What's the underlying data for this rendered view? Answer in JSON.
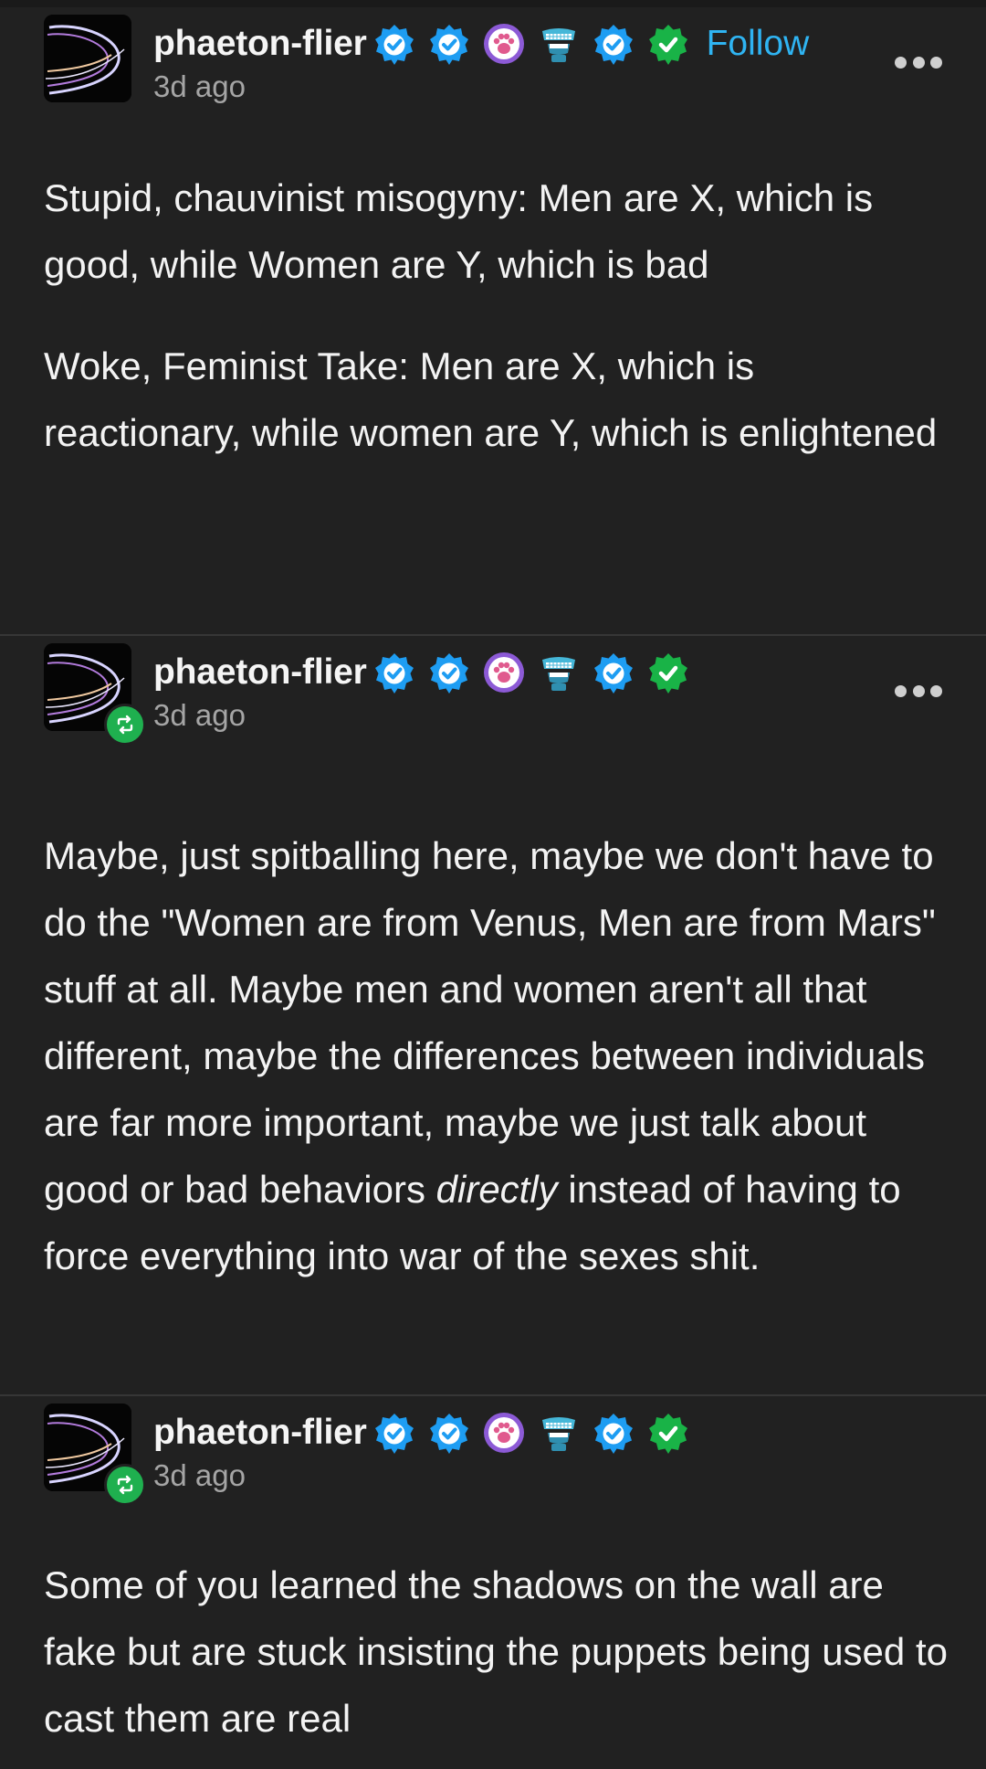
{
  "posts": [
    {
      "username": "phaeton-flier",
      "timestamp": "3d ago",
      "follow_label": "Follow",
      "reblogged": false,
      "badges": [
        "verified-blue-icon",
        "verified-blue-icon",
        "paw-badge-icon",
        "chattering-teeth-icon",
        "verified-blue-icon",
        "verified-green-icon"
      ],
      "paragraphs": [
        "Stupid, chauvinist misogyny: Men are X, which is good, while Women are Y, which is bad",
        "Woke, Feminist Take: Men are X, which is reactionary, while women are Y, which is enlightened"
      ]
    },
    {
      "username": "phaeton-flier",
      "timestamp": "3d ago",
      "reblogged": true,
      "badges": [
        "verified-blue-icon",
        "verified-blue-icon",
        "paw-badge-icon",
        "chattering-teeth-icon",
        "verified-blue-icon",
        "verified-green-icon"
      ],
      "text_before_em": "Maybe, just spitballing here, maybe we don't have to do the \"Women are from Venus, Men are from Mars\" stuff at all. Maybe men and women aren't all that different, maybe the differences between individuals are far more important, maybe we just talk about good or bad behaviors ",
      "text_em": "directly",
      "text_after_em": " instead of having to force everything into war of the sexes shit."
    },
    {
      "username": "phaeton-flier",
      "timestamp": "3d ago",
      "reblogged": true,
      "badges": [
        "verified-blue-icon",
        "verified-blue-icon",
        "paw-badge-icon",
        "chattering-teeth-icon",
        "verified-blue-icon",
        "verified-green-icon"
      ],
      "text": "Some of you learned the shadows on the wall are fake but are stuck insisting the puppets being used to cast them are real"
    }
  ],
  "colors": {
    "background": "#212121",
    "accent_follow": "#2fb4f2",
    "badge_blue": "#1e9df2",
    "badge_green": "#19b347",
    "reblog_green": "#1fb04f"
  }
}
